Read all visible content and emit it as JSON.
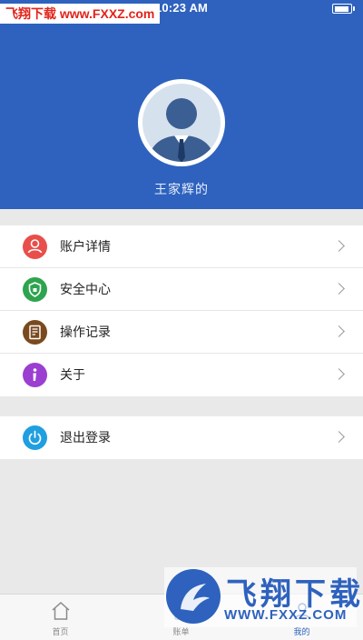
{
  "status_bar": {
    "watermark": "飞翔下载 www.FXXZ.com",
    "time": "10:23 AM",
    "battery_level": 0.9
  },
  "profile": {
    "username": "王家辉的"
  },
  "menu": {
    "items": [
      {
        "label": "账户详情",
        "icon": "user-icon",
        "color": "#e94f4a"
      },
      {
        "label": "安全中心",
        "icon": "shield-icon",
        "color": "#2ea44f"
      },
      {
        "label": "操作记录",
        "icon": "record-icon",
        "color": "#7a4a1f"
      },
      {
        "label": "关于",
        "icon": "info-icon",
        "color": "#9b3fd1"
      }
    ],
    "logout": {
      "label": "退出登录",
      "icon": "power-icon",
      "color": "#1f9fe0"
    }
  },
  "tabbar": {
    "tabs": [
      {
        "label": "首页",
        "icon": "home-icon"
      },
      {
        "label": "账单",
        "icon": "bill-icon"
      },
      {
        "label": "我的",
        "icon": "profile-icon",
        "active": true
      }
    ]
  },
  "watermark_logo": {
    "title": "飞翔下载",
    "url": "WWW.FXXZ.COM"
  },
  "colors": {
    "header_bg": "#2e62be",
    "page_bg": "#e9e9e9",
    "accent": "#2e62be"
  }
}
